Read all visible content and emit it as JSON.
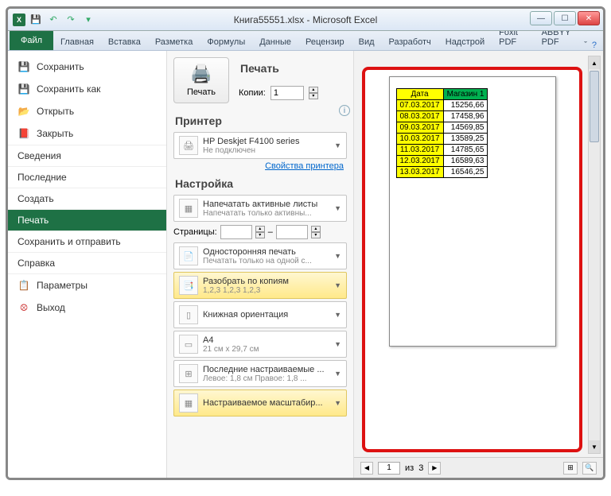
{
  "window": {
    "title": "Книга55551.xlsx - Microsoft Excel"
  },
  "ribbon": {
    "file": "Файл",
    "tabs": [
      "Главная",
      "Вставка",
      "Разметка",
      "Формулы",
      "Данные",
      "Рецензир",
      "Вид",
      "Разработч",
      "Надстрой",
      "Foxit PDF",
      "ABBYY PDF"
    ]
  },
  "backstage_items": {
    "save": "Сохранить",
    "save_as": "Сохранить как",
    "open": "Открыть",
    "close": "Закрыть",
    "info": "Сведения",
    "recent": "Последние",
    "new": "Создать",
    "print": "Печать",
    "save_send": "Сохранить и отправить",
    "help": "Справка",
    "options": "Параметры",
    "exit": "Выход"
  },
  "print": {
    "header": "Печать",
    "button": "Печать",
    "copies_label": "Копии:",
    "copies_value": "1",
    "printer_header": "Принтер",
    "printer_name": "HP Deskjet F4100 series",
    "printer_status": "Не подключен",
    "printer_props": "Свойства принтера",
    "settings_header": "Настройка",
    "active_sheets_l1": "Напечатать активные листы",
    "active_sheets_l2": "Напечатать только активны...",
    "pages_label": "Страницы:",
    "pages_sep": "–",
    "oneside_l1": "Односторонняя печать",
    "oneside_l2": "Печатать только на одной с...",
    "collate_l1": "Разобрать по копиям",
    "collate_l2": "1,2,3   1,2,3   1,2,3",
    "orient_l1": "Книжная ориентация",
    "paper_l1": "A4",
    "paper_l2": "21 см x 29,7 см",
    "margins_l1": "Последние настраиваемые ...",
    "margins_l2": "Левое: 1,8 см   Правое: 1,8 ...",
    "scale_l1": "Настраиваемое масштабир..."
  },
  "preview": {
    "page_current": "1",
    "page_sep": "из",
    "page_total": "3",
    "headers": {
      "date": "Дата",
      "store": "Магазин 1"
    },
    "rows": [
      {
        "d": "07.03.2017",
        "v": "15256,66"
      },
      {
        "d": "08.03.2017",
        "v": "17458,96"
      },
      {
        "d": "09.03.2017",
        "v": "14569,85"
      },
      {
        "d": "10.03.2017",
        "v": "13589,25"
      },
      {
        "d": "11.03.2017",
        "v": "14785,65"
      },
      {
        "d": "12.03.2017",
        "v": "16589,63"
      },
      {
        "d": "13.03.2017",
        "v": "16546,25"
      }
    ]
  }
}
